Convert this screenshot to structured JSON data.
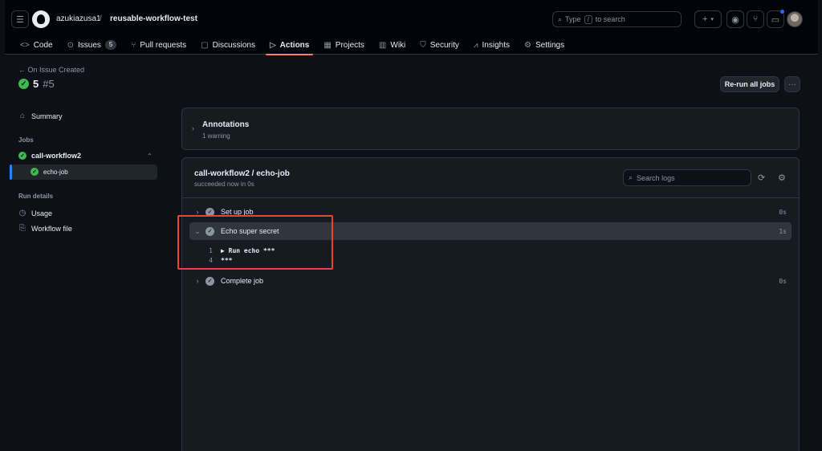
{
  "header": {
    "owner": "azukiazusa1",
    "separator": "/",
    "repo": "reusable-workflow-test",
    "search_text": "Type",
    "search_key": "/",
    "search_suffix": "to search"
  },
  "tabs": [
    {
      "label": "Code",
      "icon": "code-icon"
    },
    {
      "label": "Issues",
      "icon": "issue-icon",
      "count": "5"
    },
    {
      "label": "Pull requests",
      "icon": "pull-request-icon"
    },
    {
      "label": "Discussions",
      "icon": "discussion-icon"
    },
    {
      "label": "Actions",
      "icon": "play-icon",
      "active": true
    },
    {
      "label": "Projects",
      "icon": "table-icon"
    },
    {
      "label": "Wiki",
      "icon": "book-icon"
    },
    {
      "label": "Security",
      "icon": "shield-icon"
    },
    {
      "label": "Insights",
      "icon": "graph-icon"
    },
    {
      "label": "Settings",
      "icon": "gear-icon"
    }
  ],
  "run": {
    "back_label": "On Issue Created",
    "number": "5",
    "hash": "#5",
    "rerun_label": "Re-run all jobs"
  },
  "sidebar": {
    "summary": "Summary",
    "jobs_heading": "Jobs",
    "job_group": "call-workflow2",
    "job_item": "echo-job",
    "details_heading": "Run details",
    "usage": "Usage",
    "workflow_file": "Workflow file"
  },
  "annotations": {
    "title": "Annotations",
    "subtitle": "1 warning"
  },
  "job": {
    "title": "call-workflow2 / echo-job",
    "subtitle": "succeeded now in 0s",
    "search_placeholder": "Search logs",
    "steps": [
      {
        "name": "Set up job",
        "duration": "0s"
      },
      {
        "name": "Echo super secret",
        "duration": "1s"
      },
      {
        "name": "Complete job",
        "duration": "0s"
      }
    ],
    "log_lines": [
      {
        "num": "1",
        "text": "▶ Run echo ***"
      },
      {
        "num": "4",
        "text": "***"
      }
    ]
  },
  "colors": {
    "success": "#3fb950",
    "accent_underline": "#f78166",
    "highlight_border": "#e5453a"
  }
}
